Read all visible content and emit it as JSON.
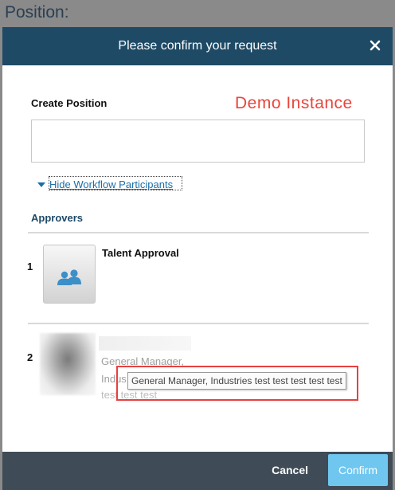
{
  "background": {
    "title": "Position:"
  },
  "dialog": {
    "title": "Please confirm your request",
    "close_icon": "close-icon"
  },
  "watermark": "Demo Instance",
  "form": {
    "label": "Create Position",
    "comment_value": "",
    "toggle_label": "Hide Workflow Participants"
  },
  "approvers": {
    "section_title": "Approvers",
    "steps": [
      {
        "number": "1",
        "title": "Talent Approval",
        "icon": "group-users-icon"
      },
      {
        "number": "2",
        "name": "",
        "line1": "General Manager,",
        "line2": "Indus",
        "line3": "test test test",
        "tooltip": "General Manager, Industries test test test test test"
      }
    ]
  },
  "footer": {
    "cancel_label": "Cancel",
    "confirm_label": "Confirm"
  },
  "colors": {
    "header": "#1e4a66",
    "footer": "#3f4b56",
    "confirm": "#6fc6ef",
    "link": "#1a6fa8",
    "watermark": "#e8453c",
    "highlight": "#e84040"
  }
}
